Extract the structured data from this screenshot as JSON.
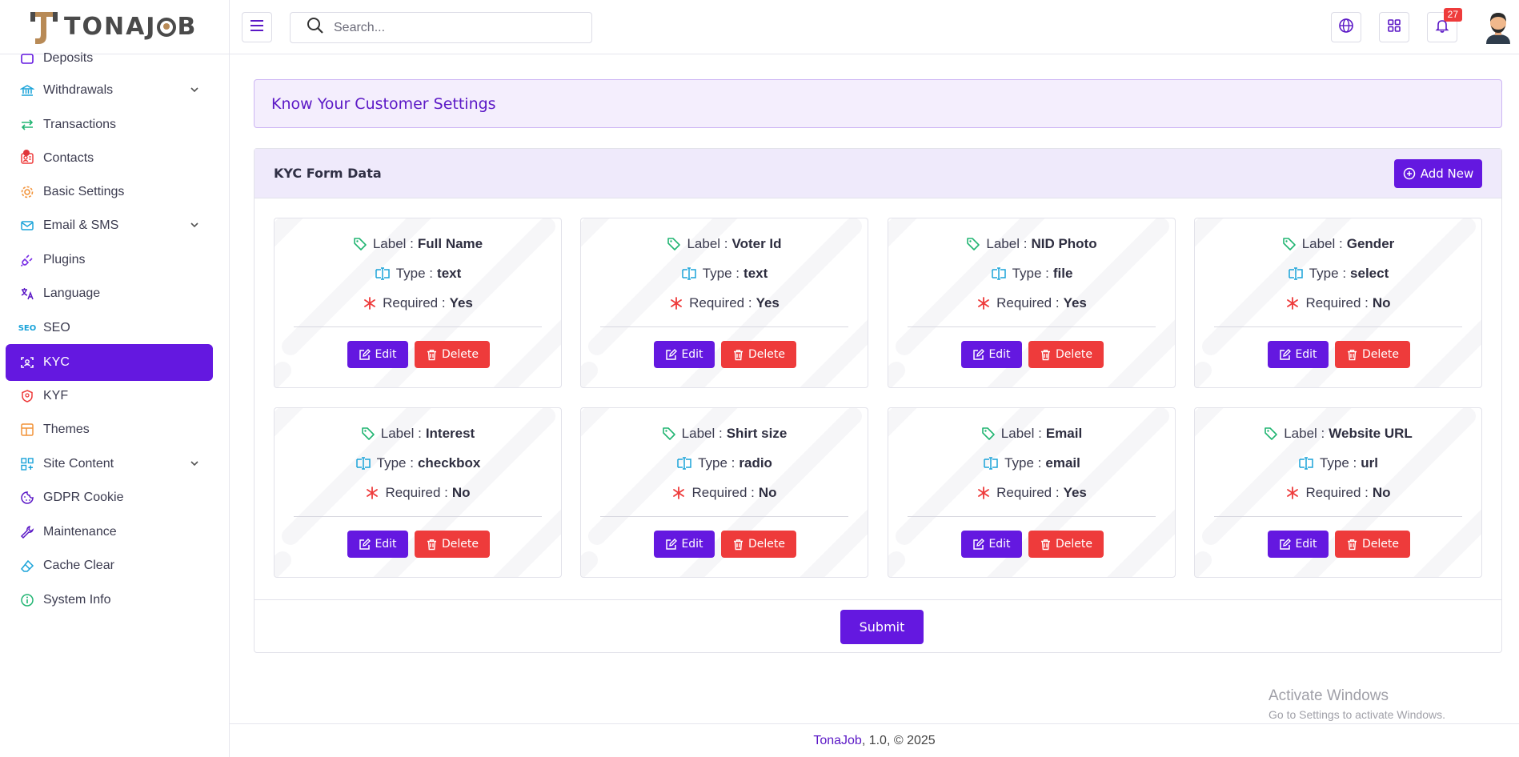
{
  "brand": {
    "name": "TONAJOB",
    "logo_letter": "J"
  },
  "search": {
    "placeholder": "Search..."
  },
  "topbar": {
    "notification_count": "27"
  },
  "sidebar": {
    "items": [
      {
        "label": "Deposits",
        "icon": "wallet-icon"
      },
      {
        "label": "Withdrawals",
        "icon": "bank-icon",
        "has_children": true
      },
      {
        "label": "Transactions",
        "icon": "arrows-swap-icon"
      },
      {
        "label": "Contacts",
        "icon": "contacts-icon"
      },
      {
        "label": "Basic Settings",
        "icon": "gear-icon"
      },
      {
        "label": "Email & SMS",
        "icon": "mail-icon",
        "has_children": true
      },
      {
        "label": "Plugins",
        "icon": "plug-icon"
      },
      {
        "label": "Language",
        "icon": "translate-icon"
      },
      {
        "label": "SEO",
        "icon": "seo-icon"
      },
      {
        "label": "KYC",
        "icon": "face-scan-icon",
        "active": true
      },
      {
        "label": "KYF",
        "icon": "shield-user-icon"
      },
      {
        "label": "Themes",
        "icon": "layout-icon"
      },
      {
        "label": "Site Content",
        "icon": "grid-plus-icon",
        "has_children": true
      },
      {
        "label": "GDPR Cookie",
        "icon": "cookie-icon"
      },
      {
        "label": "Maintenance",
        "icon": "wrench-icon"
      },
      {
        "label": "Cache Clear",
        "icon": "eraser-icon"
      },
      {
        "label": "System Info",
        "icon": "info-icon"
      }
    ]
  },
  "page": {
    "title": "Know Your Customer Settings"
  },
  "form_card": {
    "title": "KYC Form Data",
    "add_label": "Add New",
    "label_prefix": "Label :",
    "type_prefix": "Type :",
    "required_prefix": "Required :",
    "edit_label": "Edit",
    "delete_label": "Delete",
    "fields": [
      {
        "label": "Full Name",
        "type": "text",
        "required": "Yes"
      },
      {
        "label": "Voter Id",
        "type": "text",
        "required": "Yes"
      },
      {
        "label": "NID Photo",
        "type": "file",
        "required": "Yes"
      },
      {
        "label": "Gender",
        "type": "select",
        "required": "No"
      },
      {
        "label": "Interest",
        "type": "checkbox",
        "required": "No"
      },
      {
        "label": "Shirt size",
        "type": "radio",
        "required": "No"
      },
      {
        "label": "Email",
        "type": "email",
        "required": "Yes"
      },
      {
        "label": "Website URL",
        "type": "url",
        "required": "No"
      }
    ],
    "submit_label": "Submit"
  },
  "watermark": {
    "line1": "Activate Windows",
    "line2": "Go to Settings to activate Windows."
  },
  "footer": {
    "brand": "TonaJob",
    "rest": ", 1.0, © 2025"
  },
  "colors": {
    "primary": "#6418e0",
    "danger": "#ee3b3b",
    "tag_green": "#22b573",
    "type_blue": "#1aa3d9",
    "required_red": "#ee3b3b"
  }
}
